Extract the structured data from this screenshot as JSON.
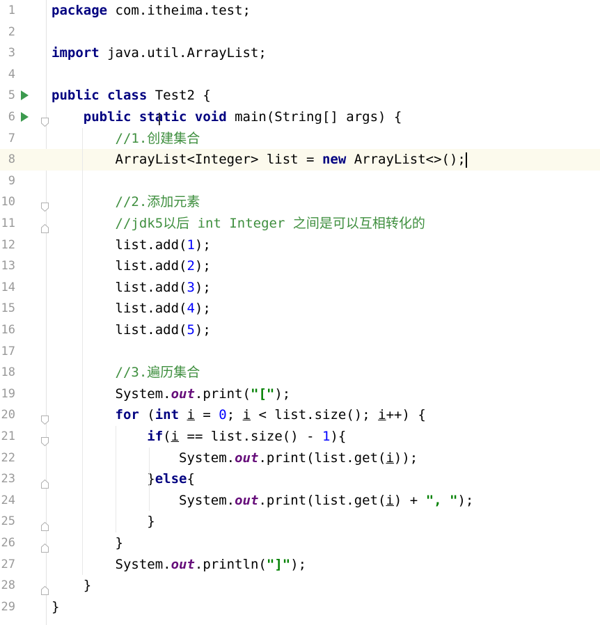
{
  "editor": {
    "lines": [
      {
        "n": "1",
        "html_tokens": [
          [
            "kw",
            "package"
          ],
          [
            "",
            " com.itheima.test;"
          ]
        ]
      },
      {
        "n": "2",
        "html_tokens": []
      },
      {
        "n": "3",
        "html_tokens": [
          [
            "kw",
            "import"
          ],
          [
            "",
            " java.util.ArrayList;"
          ]
        ]
      },
      {
        "n": "4",
        "html_tokens": []
      },
      {
        "n": "5",
        "run": true,
        "html_tokens": [
          [
            "kw",
            "public class"
          ],
          [
            "",
            " Test2 {"
          ]
        ]
      },
      {
        "n": "6",
        "run": true,
        "fold": "open",
        "html_tokens": [
          [
            "",
            "    "
          ],
          [
            "kw",
            "public static void"
          ],
          [
            "",
            " main(String[] args) {"
          ]
        ]
      },
      {
        "n": "7",
        "html_tokens": [
          [
            "",
            "        "
          ],
          [
            "cm-todo",
            "//1.创建集合"
          ]
        ]
      },
      {
        "n": "8",
        "current": true,
        "cursor": true,
        "html_tokens": [
          [
            "",
            "        ArrayList<Integer> list = "
          ],
          [
            "kw",
            "new"
          ],
          [
            "",
            " ArrayList<>();"
          ]
        ]
      },
      {
        "n": "9",
        "html_tokens": []
      },
      {
        "n": "10",
        "fold": "open",
        "html_tokens": [
          [
            "",
            "        "
          ],
          [
            "cm-todo",
            "//2.添加元素"
          ]
        ]
      },
      {
        "n": "11",
        "fold": "close",
        "html_tokens": [
          [
            "",
            "        "
          ],
          [
            "cm-todo",
            "//jdk5以后 int Integer 之间是可以互相转化的"
          ]
        ]
      },
      {
        "n": "12",
        "html_tokens": [
          [
            "",
            "        list.add("
          ],
          [
            "num",
            "1"
          ],
          [
            "",
            ");"
          ]
        ]
      },
      {
        "n": "13",
        "html_tokens": [
          [
            "",
            "        list.add("
          ],
          [
            "num",
            "2"
          ],
          [
            "",
            ");"
          ]
        ]
      },
      {
        "n": "14",
        "html_tokens": [
          [
            "",
            "        list.add("
          ],
          [
            "num",
            "3"
          ],
          [
            "",
            ");"
          ]
        ]
      },
      {
        "n": "15",
        "html_tokens": [
          [
            "",
            "        list.add("
          ],
          [
            "num",
            "4"
          ],
          [
            "",
            ");"
          ]
        ]
      },
      {
        "n": "16",
        "html_tokens": [
          [
            "",
            "        list.add("
          ],
          [
            "num",
            "5"
          ],
          [
            "",
            ");"
          ]
        ]
      },
      {
        "n": "17",
        "html_tokens": []
      },
      {
        "n": "18",
        "html_tokens": [
          [
            "",
            "        "
          ],
          [
            "cm-todo",
            "//3.遍历集合"
          ]
        ]
      },
      {
        "n": "19",
        "html_tokens": [
          [
            "",
            "        System."
          ],
          [
            "field",
            "out"
          ],
          [
            "",
            ".print("
          ],
          [
            "str",
            "\"[\""
          ],
          [
            "",
            ");"
          ]
        ]
      },
      {
        "n": "20",
        "fold": "open",
        "html_tokens": [
          [
            "",
            "        "
          ],
          [
            "kw",
            "for"
          ],
          [
            "",
            " ("
          ],
          [
            "kw",
            "int"
          ],
          [
            "",
            " "
          ],
          [
            "uvar",
            "i"
          ],
          [
            "",
            " = "
          ],
          [
            "num",
            "0"
          ],
          [
            "",
            "; "
          ],
          [
            "uvar",
            "i"
          ],
          [
            "",
            " < list.size(); "
          ],
          [
            "uvar",
            "i"
          ],
          [
            "",
            "++) {"
          ]
        ]
      },
      {
        "n": "21",
        "fold": "open",
        "html_tokens": [
          [
            "",
            "            "
          ],
          [
            "kw",
            "if"
          ],
          [
            "",
            "("
          ],
          [
            "uvar",
            "i"
          ],
          [
            "",
            " == list.size() - "
          ],
          [
            "num",
            "1"
          ],
          [
            "",
            "){"
          ]
        ]
      },
      {
        "n": "22",
        "html_tokens": [
          [
            "",
            "                System."
          ],
          [
            "field",
            "out"
          ],
          [
            "",
            ".print(list.get("
          ],
          [
            "uvar",
            "i"
          ],
          [
            "",
            "));"
          ]
        ]
      },
      {
        "n": "23",
        "fold": "close",
        "html_tokens": [
          [
            "",
            "            }"
          ],
          [
            "kw",
            "else"
          ],
          [
            "",
            "{"
          ]
        ]
      },
      {
        "n": "24",
        "html_tokens": [
          [
            "",
            "                System."
          ],
          [
            "field",
            "out"
          ],
          [
            "",
            ".print(list.get("
          ],
          [
            "uvar",
            "i"
          ],
          [
            "",
            ") + "
          ],
          [
            "str",
            "\", \""
          ],
          [
            "",
            ");"
          ]
        ]
      },
      {
        "n": "25",
        "fold": "close",
        "html_tokens": [
          [
            "",
            "            }"
          ]
        ]
      },
      {
        "n": "26",
        "fold": "close",
        "html_tokens": [
          [
            "",
            "        }"
          ]
        ]
      },
      {
        "n": "27",
        "html_tokens": [
          [
            "",
            "        System."
          ],
          [
            "field",
            "out"
          ],
          [
            "",
            ".println("
          ],
          [
            "str",
            "\"]\""
          ],
          [
            "",
            ");"
          ]
        ]
      },
      {
        "n": "28",
        "fold": "close",
        "html_tokens": [
          [
            "",
            "    }"
          ]
        ]
      },
      {
        "n": "29",
        "html_tokens": [
          [
            "",
            "}"
          ]
        ]
      }
    ]
  },
  "colors": {
    "keyword": "#000080",
    "comment": "#3f8f3f",
    "number": "#0000ff",
    "string": "#008000",
    "field": "#660e7a",
    "current_line": "#fcfaed",
    "run_icon": "#3c9a4e"
  },
  "icons": {
    "run": "run-gutter-icon",
    "fold": "fold-gutter-icon"
  }
}
